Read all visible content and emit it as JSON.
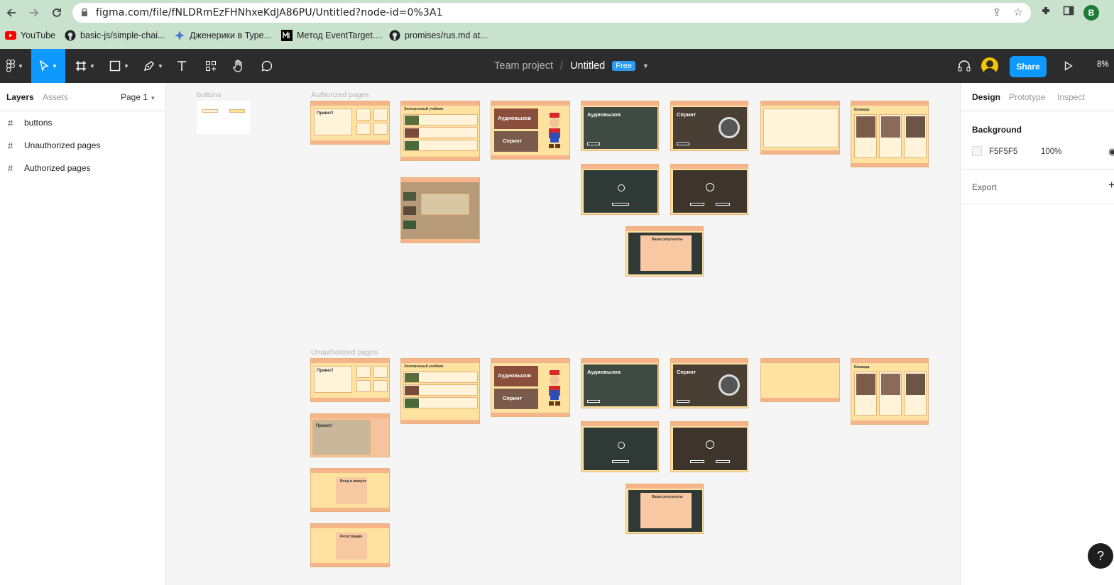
{
  "browser": {
    "url": "figma.com/file/fNLDRmEzFHNhxeKdJA86PU/Untitled?node-id=0%3A1",
    "profile_initial": "B",
    "bookmarks": [
      {
        "label": "YouTube",
        "icon": "youtube-icon"
      },
      {
        "label": "basic-js/simple-chai...",
        "icon": "github-icon"
      },
      {
        "label": "Дженерики в Туре...",
        "icon": "site-icon"
      },
      {
        "label": "Метод EventTarget....",
        "icon": "mdn-icon"
      },
      {
        "label": "promises/rus.md at...",
        "icon": "github-icon"
      }
    ]
  },
  "toolbar": {
    "team": "Team project",
    "separator": "/",
    "file_name": "Untitled",
    "plan_badge": "Free",
    "share_label": "Share",
    "zoom": "8%"
  },
  "left_panel": {
    "tabs": [
      "Layers",
      "Assets"
    ],
    "page_selector": "Page 1",
    "layers": [
      "buttons",
      "Unauthorized pages",
      "Authorized pages"
    ]
  },
  "canvas": {
    "frames": {
      "buttons": "buttons",
      "authorized": "Authorized pages",
      "unauthorized": "Unauthorized pages"
    },
    "thumb_texts": {
      "hello": "Привет!",
      "audio": "Аудиовызов",
      "sprint": "Спринт",
      "textbook": "Электронный учебник",
      "team": "Команда",
      "login": "Вход в аккаунт",
      "register": "Регистрация",
      "results": "Ваши результаты",
      "start": "НАЧАТЬ"
    }
  },
  "right_panel": {
    "tabs": [
      "Design",
      "Prototype",
      "Inspect"
    ],
    "background_title": "Background",
    "background_hex": "F5F5F5",
    "background_opacity": "100%",
    "export_title": "Export"
  },
  "colors": {
    "figma_accent": "#0d99ff",
    "browser_frame": "#c8e2cd",
    "toolbar": "#2c2c2c",
    "canvas": "#f5f5f5"
  }
}
